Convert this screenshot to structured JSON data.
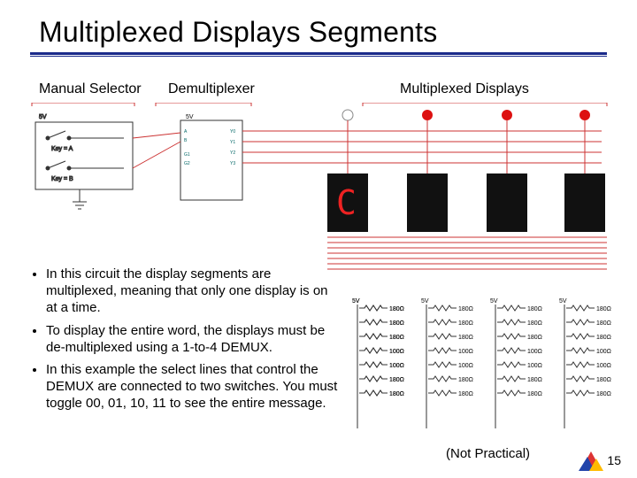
{
  "title": "Multiplexed Displays Segments",
  "labels": {
    "manual_selector": "Manual Selector",
    "demux": "Demultiplexer",
    "mux_displays": "Multiplexed Displays"
  },
  "bullets": [
    "In this circuit the display segments are multiplexed, meaning that only one display is on at a time.",
    "To display the entire word, the displays must be de-multiplexed using a 1-to-4 DEMUX.",
    "In this example the select lines that control the DEMUX are connected to two switches. You must toggle 00, 01, 10, 11 to see the entire message."
  ],
  "diagram": {
    "supply": "5V",
    "switch_a": "Key = A",
    "switch_b": "Key = B",
    "demux_part": "1-to-4 DEMUX",
    "displays": [
      "C",
      " ",
      " ",
      " "
    ],
    "probe_color": "#d11"
  },
  "resistor_nets": {
    "supply": "5V",
    "values": [
      "180Ω",
      "180Ω",
      "180Ω",
      "100Ω",
      "100Ω",
      "180Ω",
      "180Ω"
    ],
    "count": 4
  },
  "not_practical": "(Not Practical)",
  "page": "15"
}
